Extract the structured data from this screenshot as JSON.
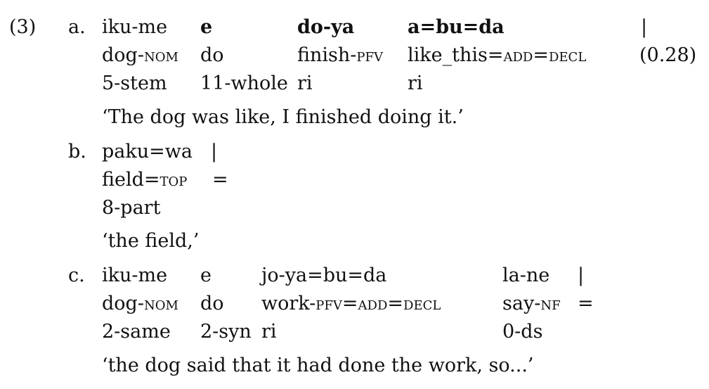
{
  "example_number": "(3)",
  "examples": [
    {
      "letter": "a.",
      "words": [
        {
          "text": "iku-me",
          "bold": false
        },
        {
          "text": "e",
          "bold": true
        },
        {
          "text": "do-ya",
          "bold": true
        },
        {
          "text": "a=bu=da",
          "bold": true
        },
        {
          "text": "|",
          "bold": false
        }
      ],
      "gloss": [
        {
          "pre": "dog-",
          "sc": "nom",
          "post": ""
        },
        {
          "pre": "do",
          "sc": "",
          "post": ""
        },
        {
          "pre": "finish-",
          "sc": "pfv",
          "post": ""
        },
        {
          "pre": "like_this=",
          "sc": "add",
          "post": "=",
          "sc2": "decl"
        },
        {
          "pre": "(0.28)",
          "sc": "",
          "post": ""
        }
      ],
      "tags": [
        "5-stem",
        "11-whole",
        "ri",
        "ri"
      ],
      "translation": "‘The dog was like, I finished doing it.’"
    },
    {
      "letter": "b.",
      "words": [
        {
          "text": "paku=wa",
          "bold": false
        },
        {
          "text": "|",
          "bold": false
        }
      ],
      "gloss": [
        {
          "pre": "field=",
          "sc": "top",
          "post": ""
        },
        {
          "pre": "=",
          "sc": "",
          "post": ""
        }
      ],
      "tags": [
        "8-part"
      ],
      "translation": "‘the field,’"
    },
    {
      "letter": "c.",
      "words": [
        {
          "text": "iku-me",
          "bold": false
        },
        {
          "text": "e",
          "bold": false
        },
        {
          "text": "jo-ya=bu=da",
          "bold": false
        },
        {
          "text": "la-ne",
          "bold": false
        },
        {
          "text": "|",
          "bold": false
        }
      ],
      "gloss": [
        {
          "pre": "dog-",
          "sc": "nom",
          "post": ""
        },
        {
          "pre": "do",
          "sc": "",
          "post": ""
        },
        {
          "pre": "work-",
          "sc": "pfv",
          "post": "=",
          "sc2": "add",
          "post2": "=",
          "sc3": "decl"
        },
        {
          "pre": "say-",
          "sc": "nf",
          "post": ""
        },
        {
          "pre": "=",
          "sc": "",
          "post": ""
        }
      ],
      "tags": [
        "2-same",
        "2-syn",
        "ri",
        "0-ds"
      ],
      "translation": "‘the dog said that it had done the work, so...’"
    }
  ]
}
